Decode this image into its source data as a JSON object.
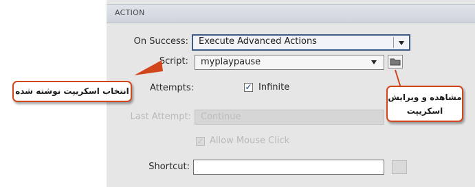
{
  "panel": {
    "title": "ACTION"
  },
  "fields": {
    "on_success": {
      "label": "On Success:",
      "value": "Execute Advanced Actions"
    },
    "script": {
      "label": "Script:",
      "value": "myplaypause"
    },
    "attempts": {
      "label": "Attempts:",
      "checkbox_label": "Infinite",
      "checked": true
    },
    "last_attempt": {
      "label": "Last Attempt:",
      "value": "Continue"
    },
    "mouse_click": {
      "label": "Allow Mouse Click",
      "checked": true
    },
    "shortcut": {
      "label": "Shortcut:",
      "value": ""
    }
  },
  "callouts": {
    "left": "انتخاب اسکریپت نوشته شده",
    "right_line1": "مشاهده و ویرایش",
    "right_line2": "اسکریپت"
  },
  "colors": {
    "callout_border": "#d1461b",
    "highlight_border": "#3f5b88",
    "panel_bg": "#e6e6e6"
  }
}
